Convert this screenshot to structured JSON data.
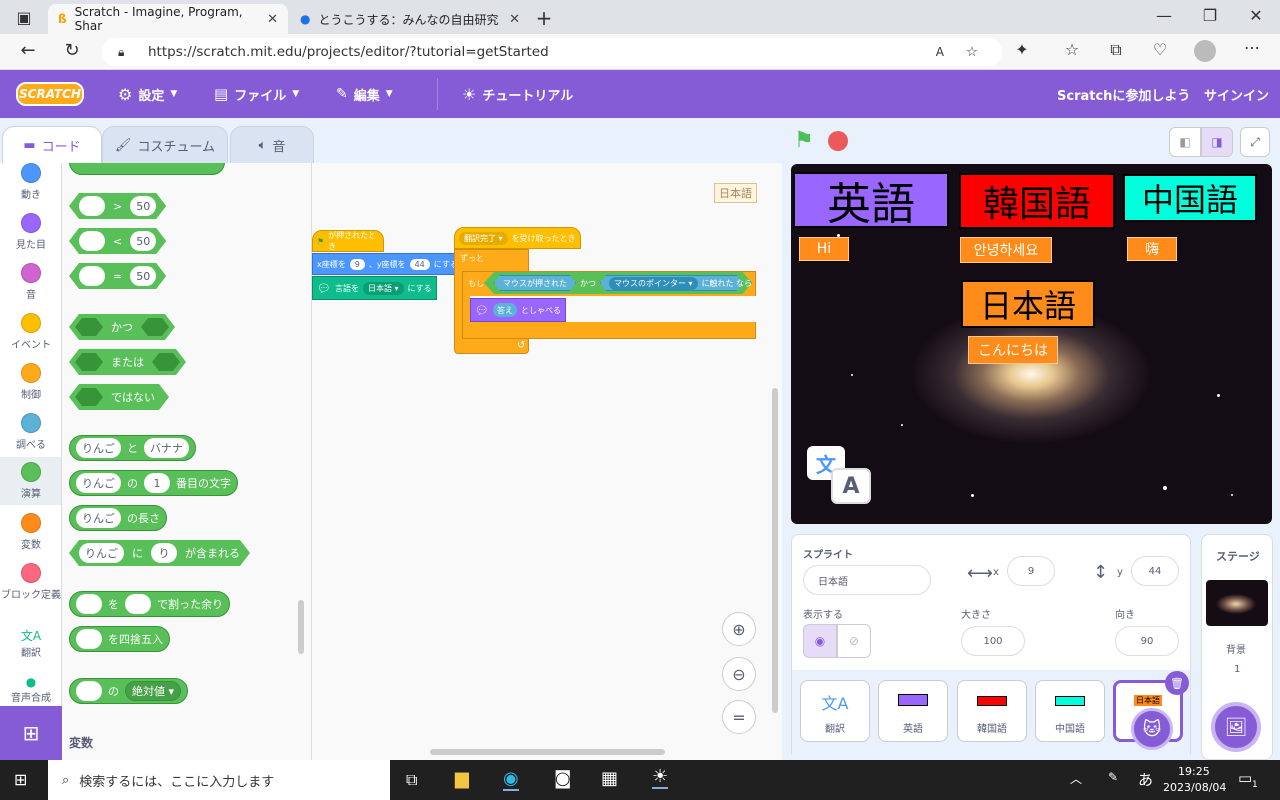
{
  "browser": {
    "tabs": [
      {
        "title": "Scratch - Imagine, Program, Shar",
        "active": true
      },
      {
        "title": "とうこうする：みんなの自由研究紹介",
        "active": false
      }
    ],
    "url": "https://scratch.mit.edu/projects/editor/?tutorial=getStarted"
  },
  "menubar": {
    "logo": "SCRATCH",
    "settings": "設定",
    "file": "ファイル",
    "edit": "編集",
    "tutorial": "チュートリアル",
    "join": "Scratchに参加しよう",
    "signin": "サインイン"
  },
  "editor_tabs": {
    "code": "コード",
    "costume": "コスチューム",
    "sound": "音"
  },
  "categories": [
    {
      "label": "動き",
      "color": "#4c97ff"
    },
    {
      "label": "見た目",
      "color": "#9966ff"
    },
    {
      "label": "音",
      "color": "#cf63cf"
    },
    {
      "label": "イベント",
      "color": "#ffbf00"
    },
    {
      "label": "制御",
      "color": "#ffab19"
    },
    {
      "label": "調べる",
      "color": "#5cb1d6"
    },
    {
      "label": "演算",
      "color": "#59c059"
    },
    {
      "label": "変数",
      "color": "#ff8c1a"
    },
    {
      "label": "ブロック定義",
      "color": "#ff6680"
    },
    {
      "label": "翻訳",
      "color": "#0fbd8c"
    },
    {
      "label": "音声合成",
      "color": "#0fbd8c"
    }
  ],
  "palette": {
    "gt": ">",
    "lt": "<",
    "eq": "=",
    "num50": "50",
    "and": "かつ",
    "or": "または",
    "not": "ではない",
    "join_a": "りんご",
    "join_word": "と",
    "join_b": "バナナ",
    "letter_a": "りんご",
    "letter_of": "の",
    "letter_n": "1",
    "letter_suffix": "番目の文字",
    "length_a": "りんご",
    "length_suffix": "の長さ",
    "contains_a": "りんご",
    "contains_ni": "に",
    "contains_b": "り",
    "contains_suffix": "が含まれる",
    "mod_wo": "を",
    "mod_suffix": "で割った余り",
    "round_suffix": "を四捨五入",
    "abs_of": "の",
    "abs_fn": "絶対値",
    "variables_heading": "変数"
  },
  "code": {
    "sprite_badge": "日本語",
    "script1": {
      "hat": "が押されたとき",
      "goto_x_label": "x座標を",
      "goto_x": "9",
      "goto_y_label": "、y座標を",
      "goto_y": "44",
      "goto_suffix": "にする",
      "lang_label": "言語を",
      "lang_value": "日本語",
      "lang_suffix": "にする"
    },
    "script2": {
      "hat_value": "翻訳完了",
      "hat_suffix": "を受け取ったとき",
      "forever": "ずっと",
      "if": "もし",
      "cond1": "マウスが押された",
      "and": "かつ",
      "cond2_value": "マウスのポインター",
      "cond2_suffix": "に触れた",
      "then": "なら",
      "say_value": "答え",
      "say_suffix": "としゃべる"
    }
  },
  "stage": {
    "labels": {
      "english": "英語",
      "korean": "韓国語",
      "chinese": "中国語",
      "japanese": "日本語",
      "hi": "Hi",
      "annyeong": "안녕하세요",
      "hai": "嗨",
      "konnichiwa": "こんにちは"
    },
    "colors": {
      "english_bg": "#9966ff",
      "korean_bg": "#ff0000",
      "chinese_bg": "#00ffdd",
      "japanese_bg": "#ff8c1a"
    }
  },
  "sprite_info": {
    "heading": "スプライト",
    "name": "日本語",
    "x_label": "x",
    "x": "9",
    "y_label": "y",
    "y": "44",
    "show_label": "表示する",
    "size_label": "大きさ",
    "size": "100",
    "direction_label": "向き",
    "direction": "90"
  },
  "sprites": [
    {
      "name": "翻訳"
    },
    {
      "name": "英語"
    },
    {
      "name": "韓国語"
    },
    {
      "name": "中国語"
    },
    {
      "name": "日本語",
      "selected": true
    }
  ],
  "stage_panel": {
    "heading": "ステージ",
    "backdrop_label": "背景",
    "backdrop_count": "1"
  },
  "taskbar": {
    "search_placeholder": "検索するには、ここに入力します",
    "time": "19:25",
    "date": "2023/08/04",
    "ime": "あ",
    "notif": "1"
  }
}
